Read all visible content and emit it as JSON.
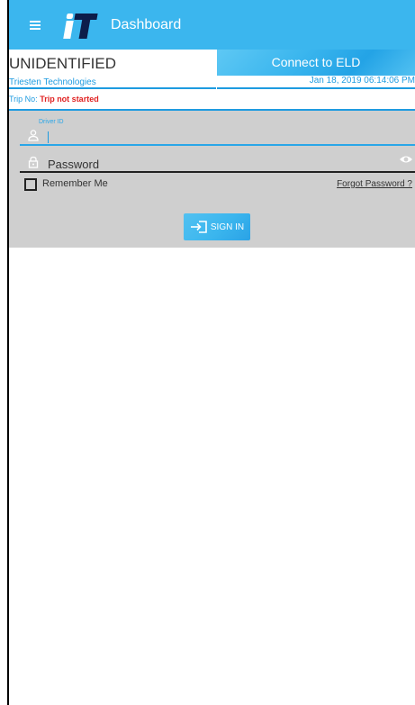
{
  "appbar": {
    "title": "Dashboard"
  },
  "status": {
    "driver_name": "UNIDENTIFIED",
    "company": "Triesten Technologies",
    "eld_button": "Connect to ELD",
    "datetime": "Jan 18, 2019 06:14:06 PM"
  },
  "trip": {
    "label": "Trip No:",
    "value": "Trip not started"
  },
  "login": {
    "driver_id_label": "Driver ID",
    "driver_id_value": "",
    "password_placeholder": "Password",
    "remember_label": "Remember Me",
    "forgot_label": "Forgot Password ?",
    "signin_label": "SIGN IN"
  },
  "colors": {
    "accent": "#3bb6ee",
    "link": "#1e9be0",
    "alert": "#e02222",
    "form_bg": "#cfcfcf"
  },
  "icons": [
    "menu-icon",
    "user-icon",
    "lock-icon",
    "eye-icon",
    "signin-icon"
  ]
}
